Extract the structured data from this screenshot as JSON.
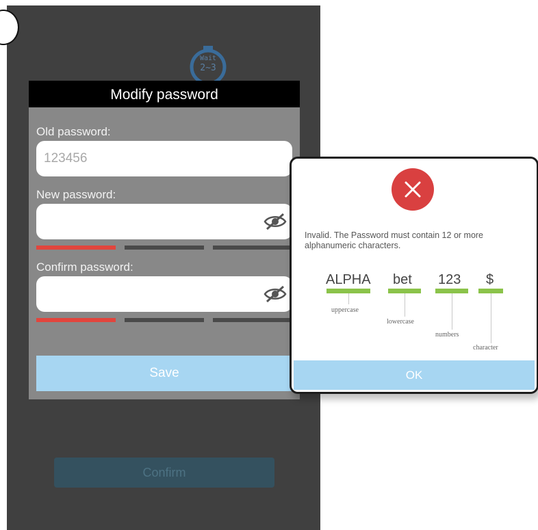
{
  "timer": {
    "line1": "Wait",
    "line2": "2~3"
  },
  "background": {
    "confirm_label": "Confirm"
  },
  "dialog": {
    "title": "Modify password",
    "old_label": "Old password:",
    "old_value": "123456",
    "new_label": "New password:",
    "confirm_label": "Confirm password:",
    "save_label": "Save",
    "new_strength_segments_filled": 1,
    "confirm_strength_segments_filled": 1,
    "strength_segments_total": 3
  },
  "popup": {
    "message": "Invalid. The Password must contain 12 or more alphanumeric characters.",
    "examples": [
      {
        "text": "ALPHA",
        "caption": "uppercase"
      },
      {
        "text": "bet",
        "caption": "lowercase"
      },
      {
        "text": "123",
        "caption": "numbers"
      },
      {
        "text": "$",
        "caption": "character"
      }
    ],
    "ok_label": "OK"
  },
  "colors": {
    "phone_bg": "#404040",
    "strength_red": "#e2453d",
    "strength_empty": "#4a4a4a",
    "button_blue": "#a7d6f2",
    "error_red": "#d94040",
    "example_green": "#8bc34a"
  }
}
